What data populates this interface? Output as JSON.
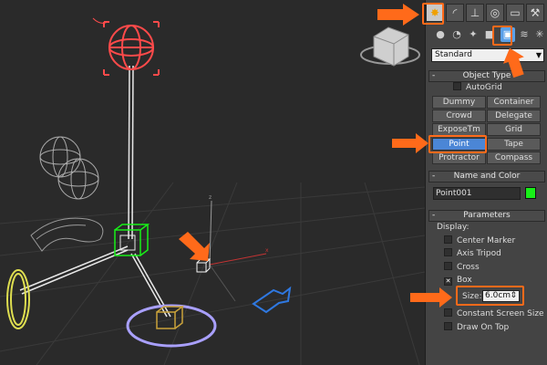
{
  "panel": {
    "dropdown_value": "Standard",
    "object_type": {
      "title": "Object Type",
      "minus": "-",
      "autogrid_label": "AutoGrid",
      "buttons": [
        {
          "label": "Dummy"
        },
        {
          "label": "Container"
        },
        {
          "label": "Crowd"
        },
        {
          "label": "Delegate"
        },
        {
          "label": "ExposeTm"
        },
        {
          "label": "Grid"
        },
        {
          "label": "Point"
        },
        {
          "label": "Tape"
        },
        {
          "label": "Protractor"
        },
        {
          "label": "Compass"
        }
      ]
    },
    "name_color": {
      "title": "Name and Color",
      "minus": "-",
      "name_value": "Point001",
      "color": "#18f018"
    },
    "parameters": {
      "title": "Parameters",
      "minus": "-",
      "display_label": "Display:",
      "checkboxes": [
        {
          "label": "Center Marker",
          "mark": ""
        },
        {
          "label": "Axis Tripod",
          "mark": ""
        },
        {
          "label": "Cross",
          "mark": ""
        },
        {
          "label": "Box",
          "mark": "✕"
        }
      ],
      "size_label": "Size:",
      "size_value": "6.0cm",
      "spinner": "⇕",
      "constant_label": "Constant Screen Size",
      "draw_on_top_label": "Draw On Top"
    }
  },
  "icons": {
    "create": "✸",
    "modify": "◜",
    "hierarchy": "⊥",
    "motion": "◎",
    "display": "▭",
    "utilities": "⚒",
    "geometry": "●",
    "shapes": "◔",
    "lights": "✦",
    "cameras": "■",
    "helpers": "▣",
    "spacewarps": "≋",
    "systems": "✳",
    "dropdown_arrow": "▼"
  },
  "colors": {
    "accent_orange": "#ff6a1a",
    "active_blue": "#4b86d6",
    "selection_green": "#18f018"
  }
}
